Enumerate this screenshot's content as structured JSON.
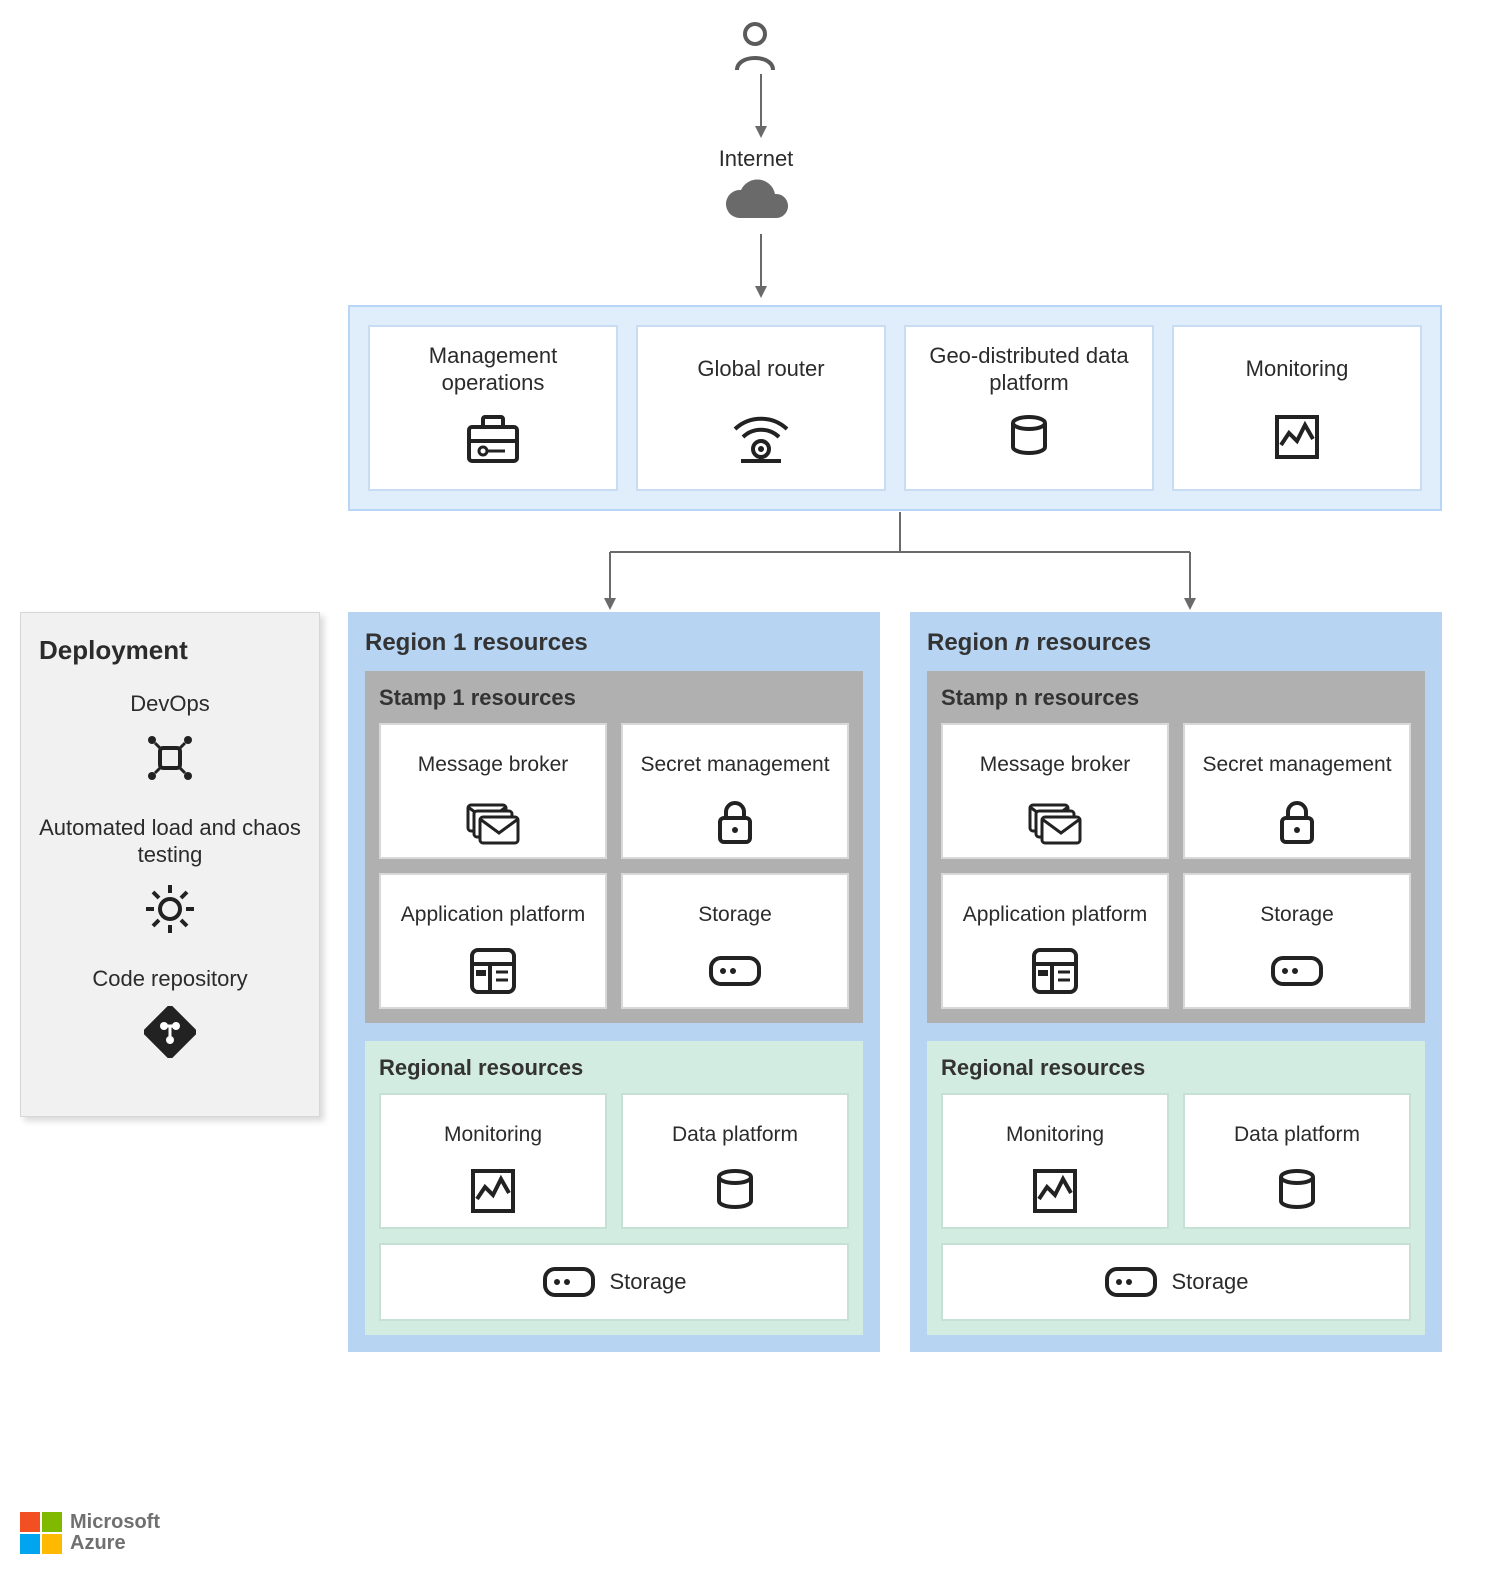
{
  "top": {
    "internet_label": "Internet"
  },
  "global": {
    "cards": [
      {
        "label": "Management operations",
        "icon": "toolbox-icon"
      },
      {
        "label": "Global router",
        "icon": "router-icon"
      },
      {
        "label": "Geo-distributed data platform",
        "icon": "database-icon"
      },
      {
        "label": "Monitoring",
        "icon": "monitoring-icon"
      }
    ]
  },
  "deployment": {
    "title": "Deployment",
    "items": [
      {
        "label": "DevOps",
        "icon": "devops-icon"
      },
      {
        "label": "Automated load and chaos testing",
        "icon": "gear-icon"
      },
      {
        "label": "Code repository",
        "icon": "git-icon"
      }
    ]
  },
  "regions": [
    {
      "title_prefix": "Region ",
      "title_id": "1",
      "title_suffix": " resources",
      "italic_id": false,
      "stamp": {
        "title": "Stamp 1 resources",
        "cards": [
          {
            "label": "Message broker",
            "icon": "message-icon"
          },
          {
            "label": "Secret management",
            "icon": "lock-icon"
          },
          {
            "label": "Application platform",
            "icon": "app-platform-icon"
          },
          {
            "label": "Storage",
            "icon": "storage-icon"
          }
        ]
      },
      "regional": {
        "title": "Regional resources",
        "cards": [
          {
            "label": "Monitoring",
            "icon": "monitoring-icon"
          },
          {
            "label": "Data platform",
            "icon": "database-icon"
          }
        ],
        "storage_label": "Storage"
      }
    },
    {
      "title_prefix": "Region ",
      "title_id": "n",
      "title_suffix": " resources",
      "italic_id": true,
      "stamp": {
        "title": "Stamp n resources",
        "cards": [
          {
            "label": "Message broker",
            "icon": "message-icon"
          },
          {
            "label": "Secret management",
            "icon": "lock-icon"
          },
          {
            "label": "Application platform",
            "icon": "app-platform-icon"
          },
          {
            "label": "Storage",
            "icon": "storage-icon"
          }
        ]
      },
      "regional": {
        "title": "Regional resources",
        "cards": [
          {
            "label": "Monitoring",
            "icon": "monitoring-icon"
          },
          {
            "label": "Data platform",
            "icon": "database-icon"
          }
        ],
        "storage_label": "Storage"
      }
    }
  ],
  "logo": {
    "line1": "Microsoft",
    "line2": "Azure"
  }
}
